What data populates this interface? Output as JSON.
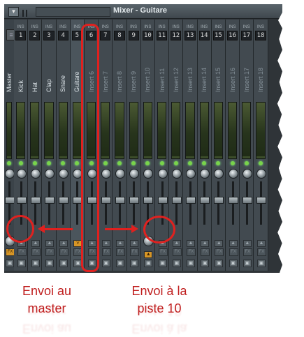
{
  "window": {
    "title": "Mixer - Guitare",
    "menu_icon": "▼"
  },
  "ins_label": "INS",
  "master": {
    "label": "Master",
    "icon": "≡",
    "fx_label": "FX"
  },
  "tracks": [
    {
      "num": "1",
      "label": "Kick"
    },
    {
      "num": "2",
      "label": "Hat"
    },
    {
      "num": "3",
      "label": "Clap"
    },
    {
      "num": "4",
      "label": "Snare"
    },
    {
      "num": "5",
      "label": "Guitare",
      "selected": true
    },
    {
      "num": "6",
      "label": "Insert 6"
    },
    {
      "num": "7",
      "label": "Insert 7"
    },
    {
      "num": "8",
      "label": "Insert 8"
    },
    {
      "num": "9",
      "label": "Insert 9"
    },
    {
      "num": "10",
      "label": "Insert 10"
    },
    {
      "num": "11",
      "label": "Insert 11"
    },
    {
      "num": "12",
      "label": "Insert 12"
    },
    {
      "num": "13",
      "label": "Insert 13"
    },
    {
      "num": "14",
      "label": "Insert 14"
    },
    {
      "num": "15",
      "label": "Insert 15"
    },
    {
      "num": "16",
      "label": "Insert 16"
    },
    {
      "num": "17",
      "label": "Insert 17"
    },
    {
      "num": "18",
      "label": "Insert 18"
    }
  ],
  "icons": {
    "send_arrow": "▲",
    "send_active": "⋎",
    "disk": "▣",
    "fx": "FX"
  },
  "annotations": {
    "master_send": "Envoi au master",
    "track_send": "Envoi à la piste 10",
    "color": "#e0211f"
  },
  "colors": {
    "mixer_bg": "#2f3438",
    "strip": "#424a50",
    "active_send": "#d69526",
    "led": "#79d44a"
  }
}
